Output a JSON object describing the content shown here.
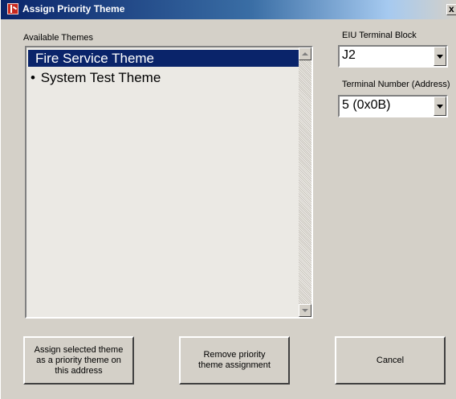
{
  "window": {
    "title": "Assign Priority Theme",
    "close_label": "x"
  },
  "available_themes": {
    "label": "Available Themes",
    "items": [
      {
        "label": "Fire Service Theme",
        "bullet": "",
        "selected": true
      },
      {
        "label": "System Test Theme",
        "bullet": "•",
        "selected": false
      }
    ]
  },
  "eiu_terminal_block": {
    "label": "EIU Terminal Block",
    "value": "J2"
  },
  "terminal_number": {
    "label": "Terminal Number (Address)",
    "value": "5 (0x0B)"
  },
  "buttons": {
    "assign": "Assign selected theme\nas a priority theme on\nthis address",
    "remove": "Remove priority\ntheme assignment",
    "cancel": "Cancel"
  },
  "colors": {
    "selection": "#0a246a",
    "face": "#d4d0c8",
    "title_gradient_start": "#0a246a"
  }
}
